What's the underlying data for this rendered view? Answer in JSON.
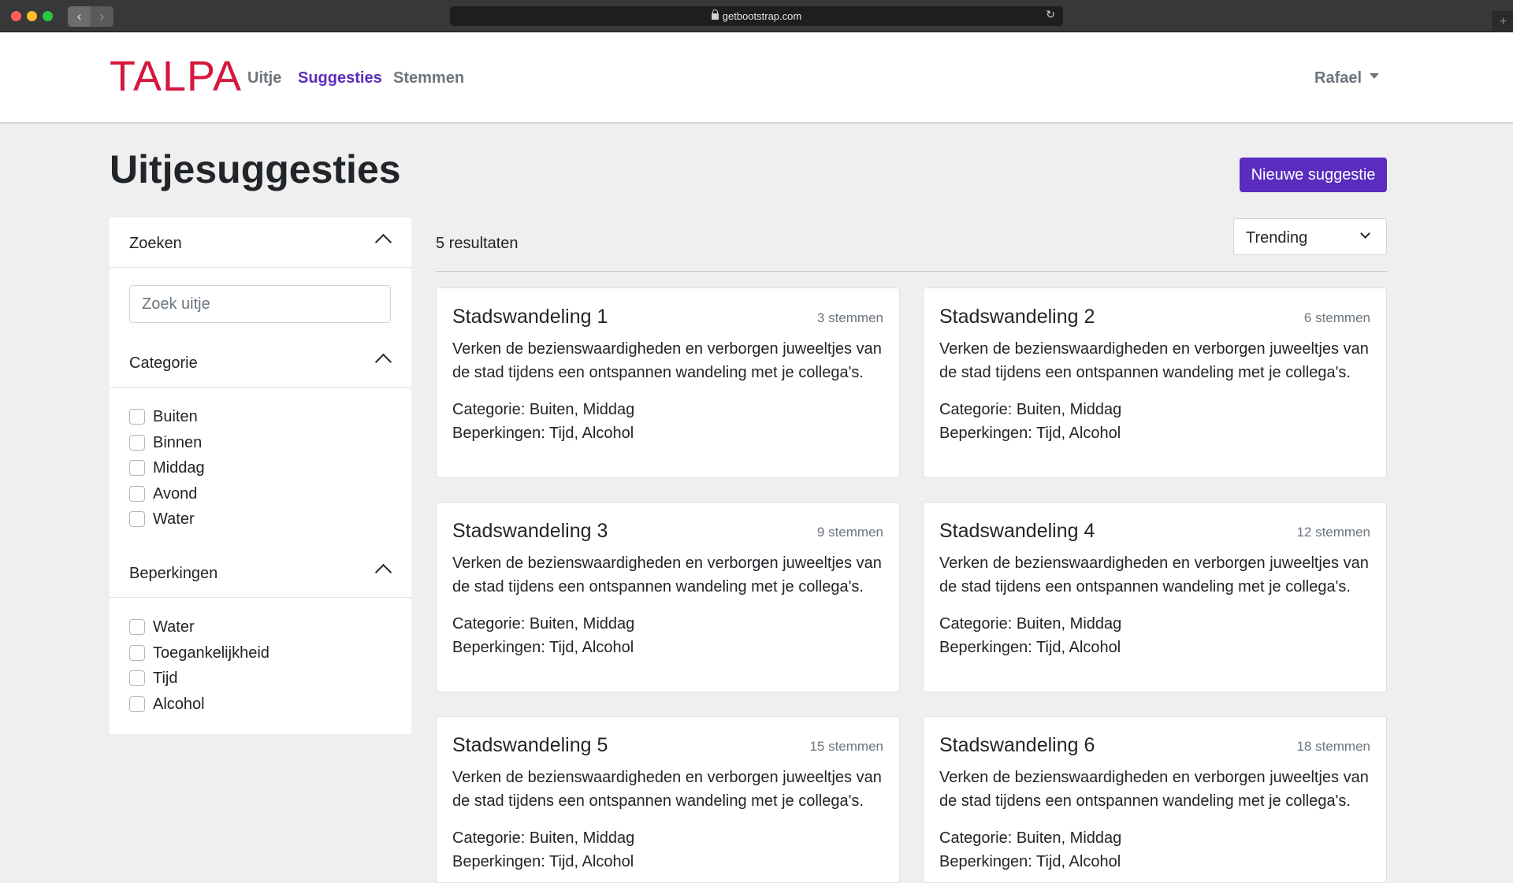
{
  "browser": {
    "url": "getbootstrap.com"
  },
  "nav": {
    "brand": "TALPA",
    "links": [
      {
        "label": "Uitje",
        "active": false
      },
      {
        "label": "Suggesties",
        "active": true
      },
      {
        "label": "Stemmen",
        "active": false
      }
    ],
    "user": "Rafael"
  },
  "header": {
    "title": "Uitjesuggesties",
    "new_button": "Nieuwe suggestie"
  },
  "sidebar": {
    "search": {
      "heading": "Zoeken",
      "placeholder": "Zoek uitje"
    },
    "categorie": {
      "heading": "Categorie",
      "options": [
        "Buiten",
        "Binnen",
        "Middag",
        "Avond",
        "Water"
      ]
    },
    "beperkingen": {
      "heading": "Beperkingen",
      "options": [
        "Water",
        "Toegankelijkheid",
        "Tijd",
        "Alcohol"
      ]
    }
  },
  "results": {
    "count": "5 resultaten",
    "sort": "Trending",
    "cards": [
      {
        "title": "Stadswandeling 1",
        "votes": "3 stemmen",
        "description": "Verken de bezienswaardigheden en verborgen juweeltjes van de stad tijdens een ontspannen wandeling met je collega's.",
        "categorie": "Categorie: Buiten, Middag",
        "beperkingen": "Beperkingen: Tijd, Alcohol"
      },
      {
        "title": "Stadswandeling 2",
        "votes": "6 stemmen",
        "description": "Verken de bezienswaardigheden en verborgen juweeltjes van de stad tijdens een ontspannen wandeling met je collega's.",
        "categorie": "Categorie: Buiten, Middag",
        "beperkingen": "Beperkingen: Tijd, Alcohol"
      },
      {
        "title": "Stadswandeling 3",
        "votes": "9 stemmen",
        "description": "Verken de bezienswaardigheden en verborgen juweeltjes van de stad tijdens een ontspannen wandeling met je collega's.",
        "categorie": "Categorie: Buiten, Middag",
        "beperkingen": "Beperkingen: Tijd, Alcohol"
      },
      {
        "title": "Stadswandeling 4",
        "votes": "12 stemmen",
        "description": "Verken de bezienswaardigheden en verborgen juweeltjes van de stad tijdens een ontspannen wandeling met je collega's.",
        "categorie": "Categorie: Buiten, Middag",
        "beperkingen": "Beperkingen: Tijd, Alcohol"
      },
      {
        "title": "Stadswandeling 5",
        "votes": "15 stemmen",
        "description": "Verken de bezienswaardigheden en verborgen juweeltjes van de stad tijdens een ontspannen wandeling met je collega's.",
        "categorie": "Categorie: Buiten, Middag",
        "beperkingen": "Beperkingen: Tijd, Alcohol"
      },
      {
        "title": "Stadswandeling 6",
        "votes": "18 stemmen",
        "description": "Verken de bezienswaardigheden en verborgen juweeltjes van de stad tijdens een ontspannen wandeling met je collega's.",
        "categorie": "Categorie: Buiten, Middag",
        "beperkingen": "Beperkingen: Tijd, Alcohol"
      }
    ]
  },
  "colors": {
    "brand": "#d6173d",
    "primary": "#5a2dbf",
    "background": "#efefef"
  }
}
